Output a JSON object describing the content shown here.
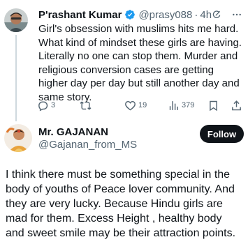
{
  "tweet": {
    "author_name": "P'rashant Kumar",
    "handle": "@prasy088",
    "separator": "·",
    "time": "4h",
    "verified_icon": "verified-badge-icon",
    "text": "Girl's obsession with muslims hits me hard. What kind of mindset these girls are having. Literally no one can stop them. Murder and religious conversion cases are getting higher day per day but still another day and same story.",
    "stats": {
      "replies": "3",
      "retweets": "",
      "likes": "19",
      "views": "379"
    },
    "colors": {
      "verified": "#1d9bf0",
      "muted": "#536471",
      "thread_line": "#cfd9de"
    }
  },
  "reply": {
    "author_name": "Mr. GAJANAN",
    "handle": "@Gajanan_from_MS",
    "follow_label": "Follow",
    "text": "I think there must be something special in the body of youths of Peace lover community. And they are very lucky.  Because Hindu girls are mad for them.  Excess Height , healthy body and sweet smile may be their attraction points.",
    "colors": {
      "follow_bg": "#0f1419",
      "follow_text": "#ffffff"
    }
  }
}
